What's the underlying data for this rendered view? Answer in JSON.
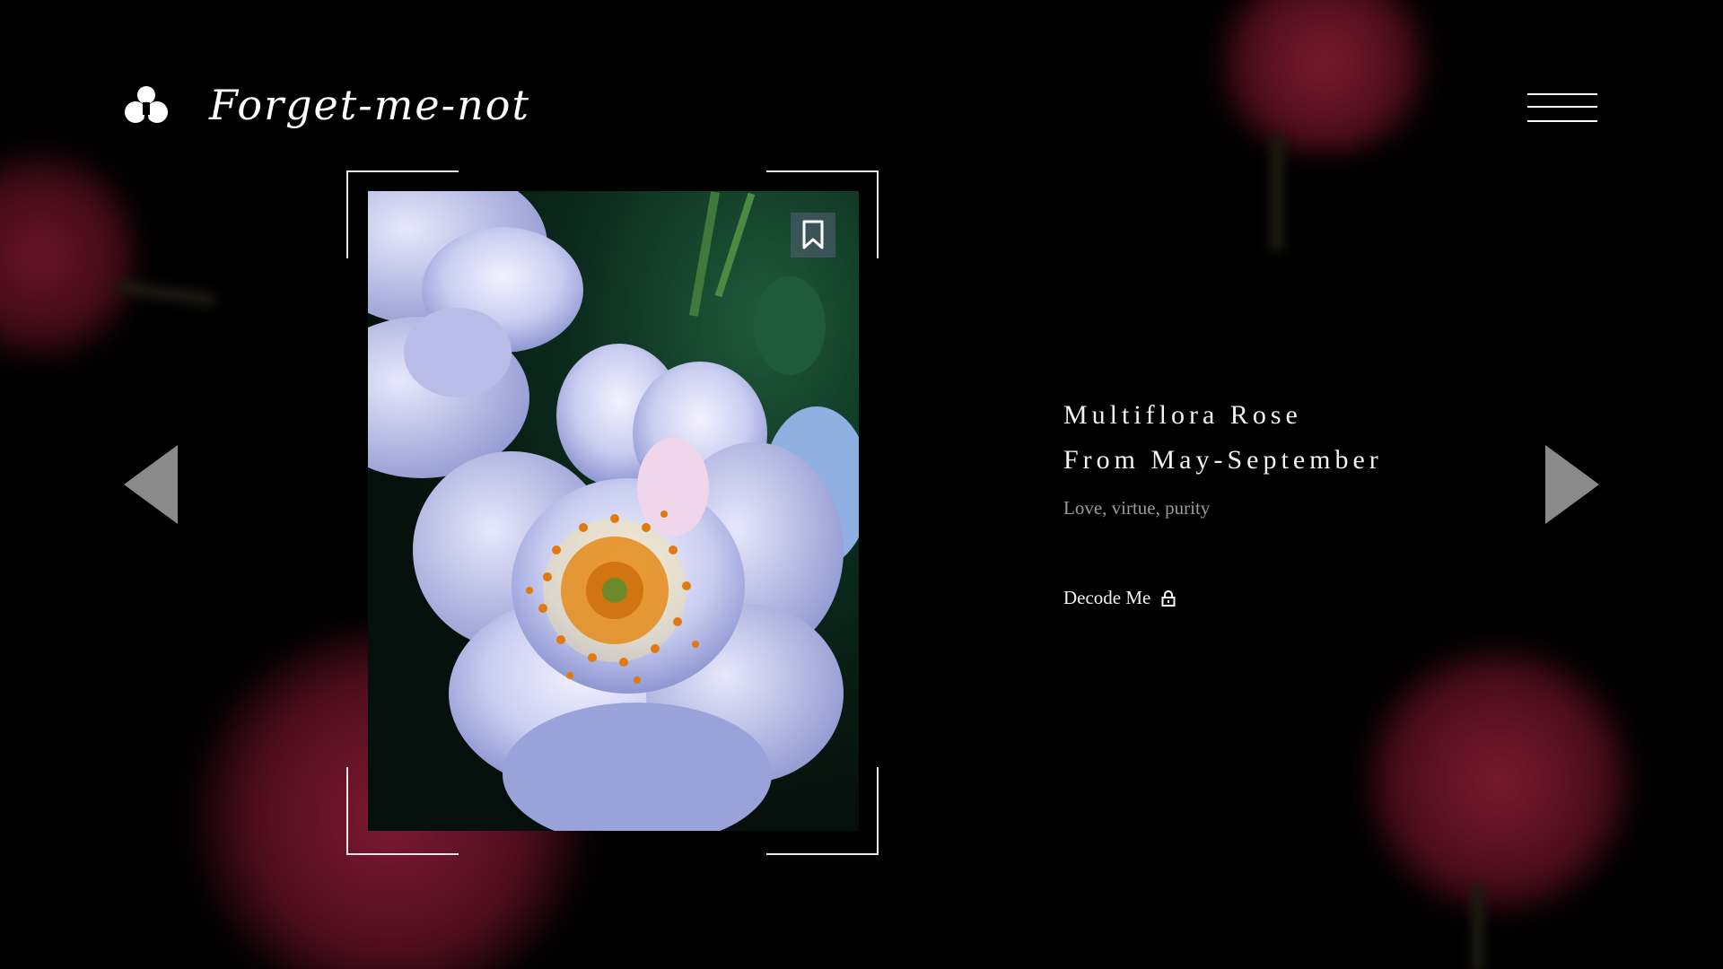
{
  "brand": {
    "name": "Forget-me-not",
    "logo_icon": "trefoil-logo-icon"
  },
  "header": {
    "menu_icon": "hamburger-menu-icon"
  },
  "navigation": {
    "prev_icon": "triangle-left-icon",
    "next_icon": "triangle-right-icon"
  },
  "flower": {
    "title_line1": "Multiflora Rose",
    "title_line2": "From May-September",
    "meaning": "Love, virtue, purity",
    "decode_label": "Decode Me",
    "decode_icon": "lock-icon",
    "bookmark_icon": "bookmark-icon"
  },
  "colors": {
    "background": "#000000",
    "text": "#f2f2f2",
    "muted_text": "#9a9a9a",
    "arrow": "#8a8a8a",
    "bg_rose": "#6e1428"
  }
}
